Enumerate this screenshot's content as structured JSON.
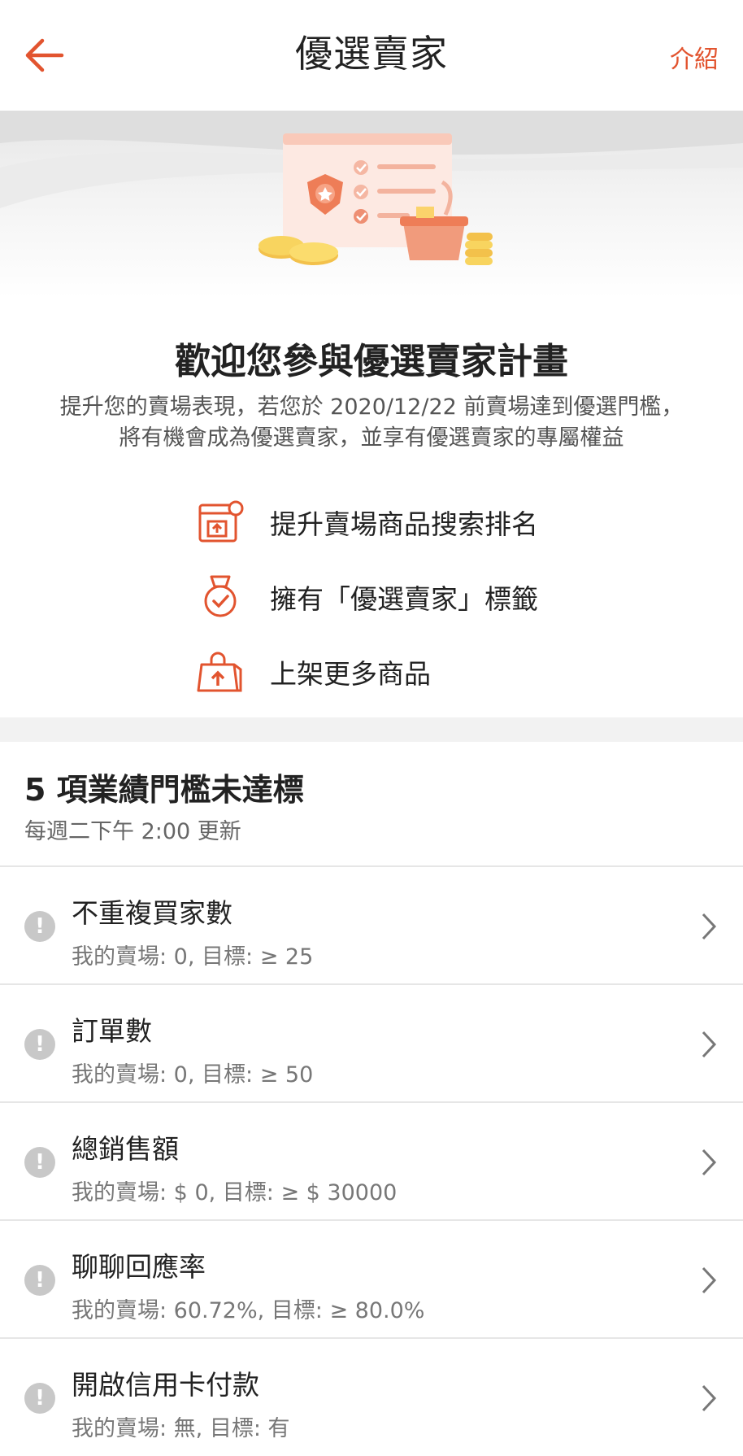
{
  "header": {
    "title": "優選賣家",
    "intro_link": "介紹",
    "back_icon": "arrow-left-icon"
  },
  "colors": {
    "accent": "#e2542f",
    "warning_icon": "#c8c8c8"
  },
  "hero": {
    "welcome": "歡迎您參與優選賣家計畫",
    "description": "提升您的賣場表現，若您於 2020/12/22 前賣場達到優選門檻，將有機會成為優選賣家，並享有優選賣家的專屬權益"
  },
  "benefits": [
    {
      "icon": "store-rank-up-icon",
      "label": "提升賣場商品搜索排名"
    },
    {
      "icon": "medal-icon",
      "label": "擁有「優選賣家」標籤"
    },
    {
      "icon": "shopping-bag-upload-icon",
      "label": "上架更多商品"
    }
  ],
  "section": {
    "title": "5 項業績門檻未達標",
    "subtitle": "每週二下午 2:00 更新"
  },
  "metrics": [
    {
      "title": "不重複買家數",
      "detail": "我的賣場: 0, 目標: ≥ 25"
    },
    {
      "title": "訂單數",
      "detail": "我的賣場: 0, 目標: ≥ 50"
    },
    {
      "title": "總銷售額",
      "detail": "我的賣場: $ 0, 目標: ≥ $ 30000"
    },
    {
      "title": "聊聊回應率",
      "detail": "我的賣場: 60.72%, 目標: ≥ 80.0%"
    },
    {
      "title": "開啟信用卡付款",
      "detail": "我的賣場: 無, 目標: 有"
    }
  ],
  "warning_symbol": "!"
}
